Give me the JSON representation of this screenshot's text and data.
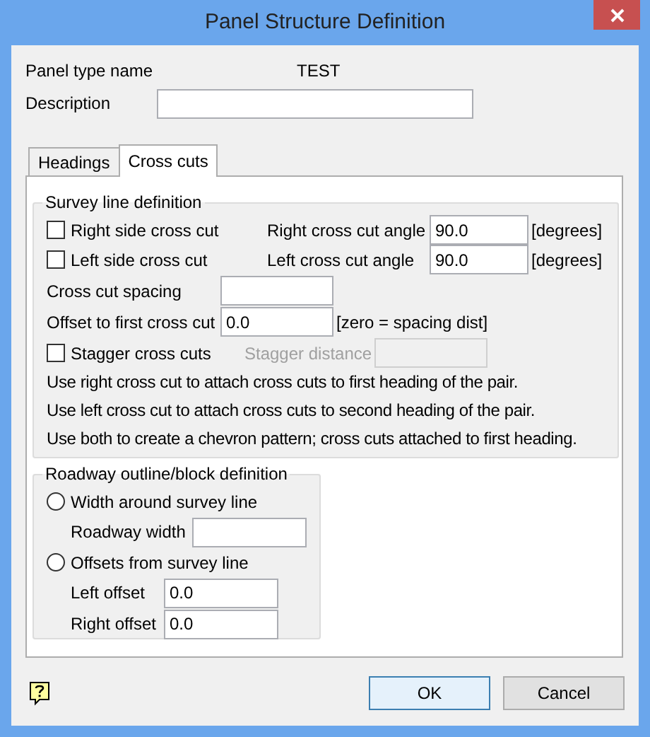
{
  "window": {
    "title": "Panel Structure Definition"
  },
  "panel_type": {
    "label": "Panel type name",
    "value": "TEST"
  },
  "description": {
    "label": "Description"
  },
  "tabs": [
    {
      "label": "Headings",
      "selected": false
    },
    {
      "label": "Cross cuts",
      "selected": true
    }
  ],
  "survey_line": {
    "title": "Survey line definition",
    "right_side": {
      "label": "Right side cross cut",
      "checked": false
    },
    "left_side": {
      "label": "Left side cross cut",
      "checked": false
    },
    "right_angle": {
      "label": "Right cross cut angle",
      "value": "90.0",
      "unit": "[degrees]"
    },
    "left_angle": {
      "label": "Left cross cut angle",
      "value": "90.0",
      "unit": "[degrees]"
    },
    "spacing": {
      "label": "Cross cut spacing"
    },
    "offset": {
      "label": "Offset to first cross cut",
      "value": "0.0",
      "note": "[zero = spacing dist]"
    },
    "stagger": {
      "label": "Stagger cross cuts",
      "checked": false
    },
    "stagger_distance": {
      "label": "Stagger distance",
      "disabled": true
    },
    "notes": [
      "Use right cross cut to attach cross cuts to first heading of the pair.",
      "Use left cross cut to attach cross cuts to second heading of the pair.",
      "Use both to create a chevron pattern; cross cuts attached to first heading."
    ]
  },
  "roadway": {
    "title": "Roadway outline/block definition",
    "options": [
      {
        "label": "Width around survey line",
        "selected": false,
        "fields": [
          {
            "label": "Roadway width"
          }
        ]
      },
      {
        "label": "Offsets from survey line",
        "selected": false,
        "fields": [
          {
            "label": "Left offset",
            "value": "0.0"
          },
          {
            "label": "Right offset",
            "value": "0.0"
          }
        ]
      }
    ]
  },
  "buttons": [
    {
      "label": "OK",
      "default": true
    },
    {
      "label": "Cancel",
      "default": false
    }
  ]
}
